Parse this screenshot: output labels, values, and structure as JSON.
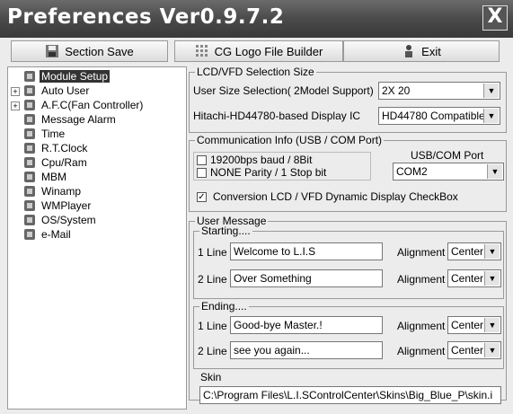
{
  "window": {
    "title": "Preferences Ver0.9.7.2",
    "close_label": "X"
  },
  "toolbar": {
    "section_save": "Section Save",
    "cg_logo": "CG Logo File Builder",
    "exit": "Exit"
  },
  "tree": {
    "items": [
      {
        "label": "Module Setup",
        "icon": "gear-icon"
      },
      {
        "label": "Auto User",
        "icon": "users-icon"
      },
      {
        "label": "A.F.C(Fan Controller)",
        "icon": "fan-icon"
      },
      {
        "label": "Message Alarm",
        "icon": "bell-icon"
      },
      {
        "label": "Time",
        "icon": "clock-icon"
      },
      {
        "label": "R.T.Clock",
        "icon": "rtclock-icon"
      },
      {
        "label": "Cpu/Ram",
        "icon": "cpu-icon"
      },
      {
        "label": "MBM",
        "icon": "mbm-icon"
      },
      {
        "label": "Winamp",
        "icon": "winamp-icon"
      },
      {
        "label": "WMPlayer",
        "icon": "wmplayer-icon"
      },
      {
        "label": "OS/System",
        "icon": "os-icon"
      },
      {
        "label": "e-Mail",
        "icon": "mail-icon"
      }
    ]
  },
  "lcd": {
    "group_label": "LCD/VFD Selection Size",
    "size_label": "User Size Selection( 2Model Support)",
    "size_value": "2X 20",
    "hitachi_label": "Hitachi-HD44780-based Display IC",
    "hitachi_value": "HD44780 Compatible"
  },
  "comm": {
    "group_label": "Communication Info (USB / COM Port)",
    "baud_label": "19200bps baud / 8Bit",
    "parity_label": "NONE Parity / 1 Stop bit",
    "port_label": "USB/COM Port",
    "port_value": "COM2",
    "conversion_label": "Conversion LCD / VFD Dynamic Display CheckBox",
    "conversion_checked": true
  },
  "user_message": {
    "group_label": "User Message",
    "starting": {
      "group_label": "Starting....",
      "line1_label": "1 Line",
      "line1_value": "Welcome to L.I.S",
      "line2_label": "2 Line",
      "line2_value": "Over Something",
      "align_label": "Alignment",
      "align1_value": "Center",
      "align2_value": "Center"
    },
    "ending": {
      "group_label": "Ending....",
      "line1_label": "1 Line",
      "line1_value": "Good-bye Master.!",
      "line2_label": "2 Line",
      "line2_value": "see you again...",
      "align_label": "Alignment",
      "align1_value": "Center",
      "align2_value": "Center"
    }
  },
  "skin": {
    "group_label": "Skin",
    "path": "C:\\Program Files\\L.I.SControlCenter\\Skins\\Big_Blue_P\\skin.i"
  }
}
